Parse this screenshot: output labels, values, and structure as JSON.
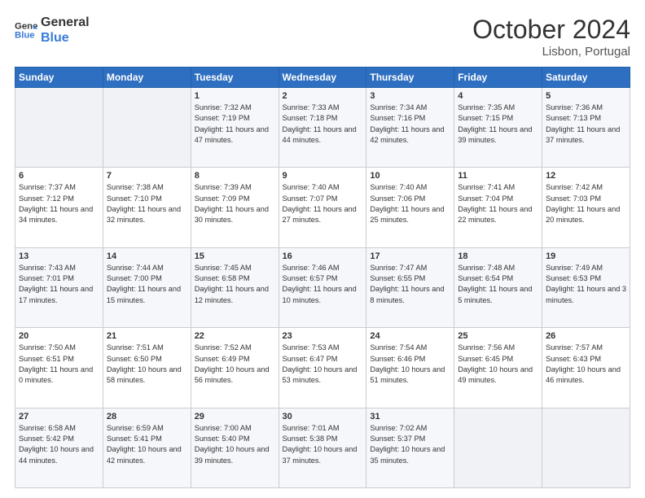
{
  "header": {
    "logo_line1": "General",
    "logo_line2": "Blue",
    "month": "October 2024",
    "location": "Lisbon, Portugal"
  },
  "days_of_week": [
    "Sunday",
    "Monday",
    "Tuesday",
    "Wednesday",
    "Thursday",
    "Friday",
    "Saturday"
  ],
  "weeks": [
    [
      {
        "day": "",
        "content": ""
      },
      {
        "day": "",
        "content": ""
      },
      {
        "day": "1",
        "content": "Sunrise: 7:32 AM\nSunset: 7:19 PM\nDaylight: 11 hours and 47 minutes."
      },
      {
        "day": "2",
        "content": "Sunrise: 7:33 AM\nSunset: 7:18 PM\nDaylight: 11 hours and 44 minutes."
      },
      {
        "day": "3",
        "content": "Sunrise: 7:34 AM\nSunset: 7:16 PM\nDaylight: 11 hours and 42 minutes."
      },
      {
        "day": "4",
        "content": "Sunrise: 7:35 AM\nSunset: 7:15 PM\nDaylight: 11 hours and 39 minutes."
      },
      {
        "day": "5",
        "content": "Sunrise: 7:36 AM\nSunset: 7:13 PM\nDaylight: 11 hours and 37 minutes."
      }
    ],
    [
      {
        "day": "6",
        "content": "Sunrise: 7:37 AM\nSunset: 7:12 PM\nDaylight: 11 hours and 34 minutes."
      },
      {
        "day": "7",
        "content": "Sunrise: 7:38 AM\nSunset: 7:10 PM\nDaylight: 11 hours and 32 minutes."
      },
      {
        "day": "8",
        "content": "Sunrise: 7:39 AM\nSunset: 7:09 PM\nDaylight: 11 hours and 30 minutes."
      },
      {
        "day": "9",
        "content": "Sunrise: 7:40 AM\nSunset: 7:07 PM\nDaylight: 11 hours and 27 minutes."
      },
      {
        "day": "10",
        "content": "Sunrise: 7:40 AM\nSunset: 7:06 PM\nDaylight: 11 hours and 25 minutes."
      },
      {
        "day": "11",
        "content": "Sunrise: 7:41 AM\nSunset: 7:04 PM\nDaylight: 11 hours and 22 minutes."
      },
      {
        "day": "12",
        "content": "Sunrise: 7:42 AM\nSunset: 7:03 PM\nDaylight: 11 hours and 20 minutes."
      }
    ],
    [
      {
        "day": "13",
        "content": "Sunrise: 7:43 AM\nSunset: 7:01 PM\nDaylight: 11 hours and 17 minutes."
      },
      {
        "day": "14",
        "content": "Sunrise: 7:44 AM\nSunset: 7:00 PM\nDaylight: 11 hours and 15 minutes."
      },
      {
        "day": "15",
        "content": "Sunrise: 7:45 AM\nSunset: 6:58 PM\nDaylight: 11 hours and 12 minutes."
      },
      {
        "day": "16",
        "content": "Sunrise: 7:46 AM\nSunset: 6:57 PM\nDaylight: 11 hours and 10 minutes."
      },
      {
        "day": "17",
        "content": "Sunrise: 7:47 AM\nSunset: 6:55 PM\nDaylight: 11 hours and 8 minutes."
      },
      {
        "day": "18",
        "content": "Sunrise: 7:48 AM\nSunset: 6:54 PM\nDaylight: 11 hours and 5 minutes."
      },
      {
        "day": "19",
        "content": "Sunrise: 7:49 AM\nSunset: 6:53 PM\nDaylight: 11 hours and 3 minutes."
      }
    ],
    [
      {
        "day": "20",
        "content": "Sunrise: 7:50 AM\nSunset: 6:51 PM\nDaylight: 11 hours and 0 minutes."
      },
      {
        "day": "21",
        "content": "Sunrise: 7:51 AM\nSunset: 6:50 PM\nDaylight: 10 hours and 58 minutes."
      },
      {
        "day": "22",
        "content": "Sunrise: 7:52 AM\nSunset: 6:49 PM\nDaylight: 10 hours and 56 minutes."
      },
      {
        "day": "23",
        "content": "Sunrise: 7:53 AM\nSunset: 6:47 PM\nDaylight: 10 hours and 53 minutes."
      },
      {
        "day": "24",
        "content": "Sunrise: 7:54 AM\nSunset: 6:46 PM\nDaylight: 10 hours and 51 minutes."
      },
      {
        "day": "25",
        "content": "Sunrise: 7:56 AM\nSunset: 6:45 PM\nDaylight: 10 hours and 49 minutes."
      },
      {
        "day": "26",
        "content": "Sunrise: 7:57 AM\nSunset: 6:43 PM\nDaylight: 10 hours and 46 minutes."
      }
    ],
    [
      {
        "day": "27",
        "content": "Sunrise: 6:58 AM\nSunset: 5:42 PM\nDaylight: 10 hours and 44 minutes."
      },
      {
        "day": "28",
        "content": "Sunrise: 6:59 AM\nSunset: 5:41 PM\nDaylight: 10 hours and 42 minutes."
      },
      {
        "day": "29",
        "content": "Sunrise: 7:00 AM\nSunset: 5:40 PM\nDaylight: 10 hours and 39 minutes."
      },
      {
        "day": "30",
        "content": "Sunrise: 7:01 AM\nSunset: 5:38 PM\nDaylight: 10 hours and 37 minutes."
      },
      {
        "day": "31",
        "content": "Sunrise: 7:02 AM\nSunset: 5:37 PM\nDaylight: 10 hours and 35 minutes."
      },
      {
        "day": "",
        "content": ""
      },
      {
        "day": "",
        "content": ""
      }
    ]
  ]
}
